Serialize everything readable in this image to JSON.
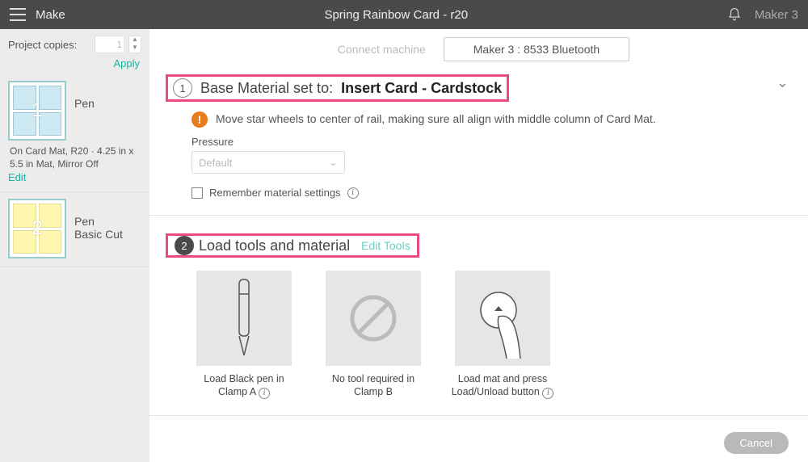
{
  "header": {
    "brand": "Make",
    "title": "Spring Rainbow Card - r20",
    "device": "Maker 3"
  },
  "sidebar": {
    "copies_label": "Project copies:",
    "copies_value": "1",
    "apply": "Apply",
    "mats": [
      {
        "num": "1",
        "ops": "Pen",
        "caption": "On Card Mat, R20 · 4.25 in x 5.5 in Mat, Mirror Off",
        "edit": "Edit"
      },
      {
        "num": "2",
        "ops_line1": "Pen",
        "ops_line2": "Basic Cut"
      }
    ]
  },
  "main": {
    "connect": "Connect machine",
    "machine": "Maker 3 : 8533 Bluetooth",
    "step1": {
      "num": "1",
      "prefix": "Base Material set to:",
      "value": "Insert Card - Cardstock",
      "warning": "Move star wheels to center of rail, making sure all align with middle column of Card Mat.",
      "pressure_label": "Pressure",
      "pressure_value": "Default",
      "remember": "Remember material settings"
    },
    "step2": {
      "num": "2",
      "title": "Load tools and material",
      "edit": "Edit Tools",
      "tools": [
        {
          "caption": "Load Black pen in Clamp A"
        },
        {
          "caption": "No tool required in Clamp B"
        },
        {
          "caption": "Load mat and press Load/Unload button"
        }
      ]
    },
    "cancel": "Cancel"
  }
}
